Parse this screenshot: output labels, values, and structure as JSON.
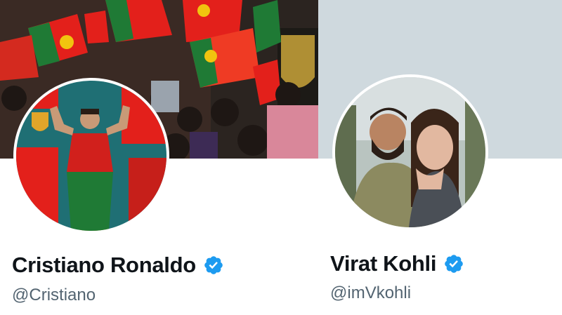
{
  "profiles": [
    {
      "display_name": "Cristiano Ronaldo",
      "handle": "@Cristiano",
      "verified": true,
      "avatar": "avatar-photo-player-in-red-green-kit",
      "banner": "banner-photo-crowd-waving-portugal-flags"
    },
    {
      "display_name": "Virat Kohli",
      "handle": "@imVkohli",
      "verified": true,
      "avatar": "avatar-photo-couple-selfie",
      "banner": "banner-empty"
    }
  ],
  "colors": {
    "verified_badge": "#1d9bf0",
    "name_text": "#0f1419",
    "handle_text": "#536471",
    "empty_banner": "#cfd9de",
    "flag_red": "#e3201b",
    "flag_green": "#1f7a35"
  },
  "icons": {
    "verified": "verified-check-icon"
  }
}
